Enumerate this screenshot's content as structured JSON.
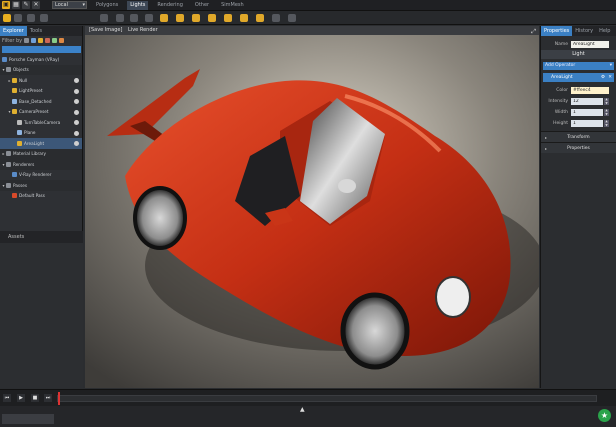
{
  "topbar": {
    "space_select": "Local",
    "menu_tabs": [
      "Polygons",
      "Lights",
      "Rendering",
      "Other",
      "SimMesh"
    ]
  },
  "left": {
    "tabs": [
      "Explorer",
      "Tools"
    ],
    "filter_label": "Filter by",
    "search_placeholder": "",
    "tree": [
      {
        "label": "Porsche Cayman (VRay)",
        "level": 0
      },
      {
        "label": "Objects",
        "level": 0
      },
      {
        "label": "Null",
        "level": 1
      },
      {
        "label": "LightPreset",
        "level": 1
      },
      {
        "label": "Base_Detached",
        "level": 1
      },
      {
        "label": "CameraPreset",
        "level": 1
      },
      {
        "label": "TurnTableCamera",
        "level": 2
      },
      {
        "label": "Plane",
        "level": 2
      },
      {
        "label": "AreaLight",
        "level": 2
      },
      {
        "label": "Material Library",
        "level": 0
      },
      {
        "label": "Renderers",
        "level": 0
      },
      {
        "label": "V-Ray Renderer",
        "level": 1
      },
      {
        "label": "Passes",
        "level": 0
      },
      {
        "label": "Default Pass",
        "level": 1
      }
    ],
    "assets_label": "Assets"
  },
  "viewport": {
    "header_items": [
      "[Save Image]",
      "Live Render"
    ]
  },
  "right": {
    "tabs": [
      "Properties",
      "History",
      "Help"
    ],
    "name_label": "Name",
    "name_value": "AreaLight",
    "light_header": "Light",
    "add_operator": "Add Operator",
    "operator_name": "AreaLight",
    "color_label": "Color",
    "color_value": "#ffeec4",
    "intensity_label": "Intensity",
    "intensity_value": "12",
    "width_label": "Width",
    "width_value": "1",
    "height_label": "Height",
    "height_value": "1",
    "sections": [
      "Transform",
      "Properties"
    ]
  },
  "colors": {
    "accent": "#3b80c4",
    "tool_yellow": "#e0a82a",
    "car_red": "#d43a1e",
    "status_green": "#2aa34a"
  }
}
